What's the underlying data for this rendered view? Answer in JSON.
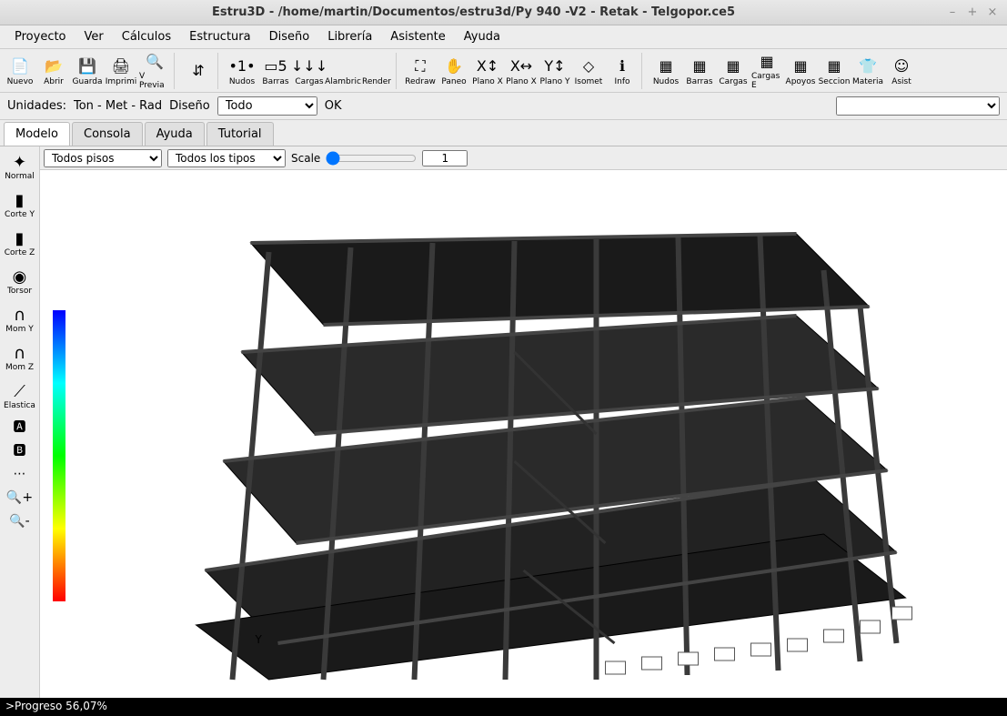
{
  "title": "Estru3D - /home/martin/Documentos/estru3d/Py 940 -V2 - Retak - Telgopor.ce5",
  "menu": [
    "Proyecto",
    "Ver",
    "Cálculos",
    "Estructura",
    "Diseño",
    "Librería",
    "Asistente",
    "Ayuda"
  ],
  "toolbar": [
    {
      "label": "Nuevo",
      "icon": "📄"
    },
    {
      "label": "Abrir",
      "icon": "📂"
    },
    {
      "label": "Guarda",
      "icon": "💾"
    },
    {
      "label": "Imprimi",
      "icon": "🖨"
    },
    {
      "label": "V Previa",
      "icon": "🔍"
    },
    {
      "sep": true
    },
    {
      "label": "",
      "icon": "⇵"
    },
    {
      "sep": true
    },
    {
      "label": "Nudos",
      "icon": "•1•"
    },
    {
      "label": "Barras",
      "icon": "▭5"
    },
    {
      "label": "Cargas",
      "icon": "↓↓↓"
    },
    {
      "label": "Alambric",
      "icon": ""
    },
    {
      "label": "Render",
      "icon": ""
    },
    {
      "sep": true
    },
    {
      "label": "Redraw",
      "icon": "⛶"
    },
    {
      "label": "Paneo",
      "icon": "✋"
    },
    {
      "label": "Plano X",
      "icon": "X↕"
    },
    {
      "label": "Plano X",
      "icon": "X↔"
    },
    {
      "label": "Plano Y",
      "icon": "Y↕"
    },
    {
      "label": "Isomet",
      "icon": "◇"
    },
    {
      "label": "Info",
      "icon": "ℹ"
    },
    {
      "sep": true
    },
    {
      "label": "Nudos",
      "icon": "▦"
    },
    {
      "label": "Barras",
      "icon": "▦"
    },
    {
      "label": "Cargas",
      "icon": "▦"
    },
    {
      "label": "Cargas E",
      "icon": "▦"
    },
    {
      "label": "Apoyos",
      "icon": "▦"
    },
    {
      "label": "Seccion",
      "icon": "▦"
    },
    {
      "label": "Materia",
      "icon": "👕"
    },
    {
      "label": "Asist",
      "icon": "☺"
    }
  ],
  "options": {
    "unidades_label": "Unidades:",
    "unidades_value": "Ton - Met - Rad",
    "diseno_label": "Diseño",
    "diseno_value": "Todo",
    "ok": "OK"
  },
  "tabs": [
    "Modelo",
    "Consola",
    "Ayuda",
    "Tutorial"
  ],
  "activeTab": 0,
  "sidetools": [
    {
      "label": "Normal",
      "icon": "✦"
    },
    {
      "label": "Corte Y",
      "icon": "▮"
    },
    {
      "label": "Corte Z",
      "icon": "▮"
    },
    {
      "label": "Torsor",
      "icon": "◉"
    },
    {
      "label": "Mom Y",
      "icon": "∩"
    },
    {
      "label": "Mom Z",
      "icon": "∩"
    },
    {
      "label": "Elastica",
      "icon": "⟋"
    }
  ],
  "sidetools2": [
    "🅰",
    "🅱",
    "⋯",
    "🔍+",
    "🔍-"
  ],
  "filter": {
    "pisos": "Todos pisos",
    "tipos": "Todos los tipos",
    "scale_label": "Scale",
    "scale_value": "1"
  },
  "axis_label": "Y",
  "status": ">Progreso 56,07%"
}
